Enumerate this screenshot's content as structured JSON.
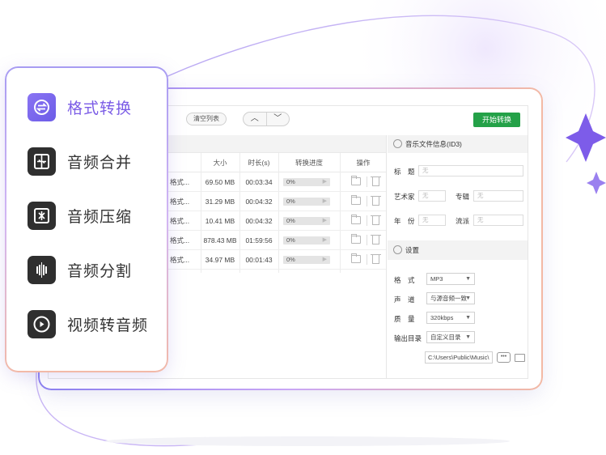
{
  "features": [
    {
      "label": "格式转换",
      "icon": "format-convert-icon",
      "active": true
    },
    {
      "label": "音频合并",
      "icon": "audio-merge-icon",
      "active": false
    },
    {
      "label": "音频压缩",
      "icon": "audio-compress-icon",
      "active": false
    },
    {
      "label": "音频分割",
      "icon": "audio-split-icon",
      "active": false
    },
    {
      "label": "视频转音频",
      "icon": "video-to-audio-icon",
      "active": false
    }
  ],
  "toolbar": {
    "clear_label": "清空列表",
    "up_label": "︿",
    "down_label": "﹀",
    "start_label": "开始转换",
    "start_color": "#24a148"
  },
  "table": {
    "headers": {
      "size": "大小",
      "duration": "时长(s)",
      "progress": "转换进度",
      "actions": "操作"
    },
    "rows": [
      {
        "name": "格式...",
        "size": "69.50 MB",
        "duration": "00:03:34",
        "progress": "0%"
      },
      {
        "name": "格式...",
        "size": "31.29 MB",
        "duration": "00:04:32",
        "progress": "0%"
      },
      {
        "name": "格式...",
        "size": "10.41 MB",
        "duration": "00:04:32",
        "progress": "0%"
      },
      {
        "name": "格式...",
        "size": "878.43 MB",
        "duration": "01:59:56",
        "progress": "0%"
      },
      {
        "name": "格式...",
        "size": "34.97 MB",
        "duration": "00:01:43",
        "progress": "0%"
      }
    ]
  },
  "id3": {
    "title": "音乐文件信息(ID3)",
    "title_label": "标　题",
    "title_placeholder": "无",
    "artist_label": "艺术家",
    "artist_placeholder": "无",
    "album_label": "专辑",
    "album_placeholder": "无",
    "year_label": "年　份",
    "year_placeholder": "无",
    "genre_label": "流派",
    "genre_placeholder": "无"
  },
  "settings": {
    "title": "设置",
    "format_label": "格　式",
    "format_value": "MP3",
    "channel_label": "声　道",
    "channel_value": "与源音频一致",
    "quality_label": "质　量",
    "quality_value": "320kbps",
    "output_label": "输出目录",
    "output_value": "自定义目录",
    "path_value": "C:\\Users\\Public\\Music\\",
    "dots_label": "•••"
  },
  "colors": {
    "accent": "#7b5ce6",
    "green": "#24a148"
  }
}
